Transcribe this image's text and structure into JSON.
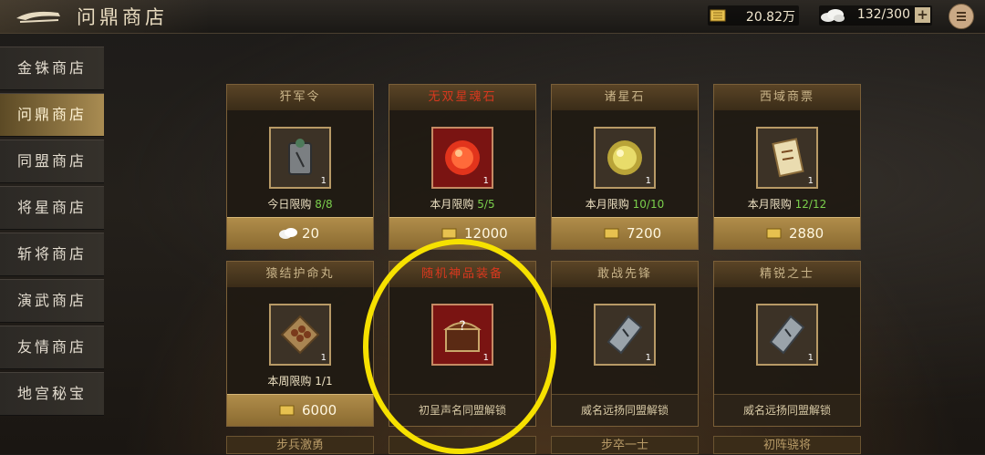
{
  "header": {
    "title": "问鼎商店",
    "gold_value": "20.82万",
    "jade_value": "132/300",
    "plus_label": "+"
  },
  "sidebar": {
    "items": [
      {
        "label": "金铢商店",
        "active": false
      },
      {
        "label": "问鼎商店",
        "active": true
      },
      {
        "label": "同盟商店",
        "active": false
      },
      {
        "label": "将星商店",
        "active": false
      },
      {
        "label": "斩将商店",
        "active": false
      },
      {
        "label": "演武商店",
        "active": false
      },
      {
        "label": "友情商店",
        "active": false
      },
      {
        "label": "地宫秘宝",
        "active": false
      }
    ]
  },
  "shop": {
    "cards": [
      {
        "name": "犴军令",
        "count": "1",
        "limit_label": "今日限购",
        "limit_value": "8/8",
        "price": "20",
        "currency_icon": "jade-icon",
        "item_icon": "token-icon"
      },
      {
        "name": "无双星魂石",
        "count": "1",
        "limit_label": "本月限购",
        "limit_value": "5/5",
        "price": "12000",
        "currency_icon": "gold-icon",
        "item_icon": "red-orb-icon"
      },
      {
        "name": "诸星石",
        "count": "1",
        "limit_label": "本月限购",
        "limit_value": "10/10",
        "price": "7200",
        "currency_icon": "gold-icon",
        "item_icon": "gold-orb-icon"
      },
      {
        "name": "西域商票",
        "count": "1",
        "limit_label": "本月限购",
        "limit_value": "12/12",
        "price": "2880",
        "currency_icon": "gold-icon",
        "item_icon": "scroll-icon"
      },
      {
        "name": "猿结护命丸",
        "count": "1",
        "limit_label": "本周限购",
        "limit_value": "1/1",
        "price": "6000",
        "currency_icon": "gold-icon",
        "item_icon": "pills-icon"
      },
      {
        "name": "随机神品装备",
        "count": "1",
        "unlock": "初呈声名同盟解锁",
        "item_icon": "chest-icon"
      },
      {
        "name": "敢战先锋",
        "count": "1",
        "unlock": "威名远扬同盟解锁",
        "item_icon": "silver-token-icon"
      },
      {
        "name": "精锐之士",
        "count": "1",
        "unlock": "威名远扬同盟解锁",
        "item_icon": "silver-token-icon"
      }
    ],
    "partial_row": [
      "步兵激勇",
      "",
      "步卒一士",
      "初阵骁将"
    ]
  },
  "colors": {
    "accent_gold": "#b08d4a",
    "highlight": "#f6e100",
    "red_title": "#d8381e",
    "limit_green": "#7bd04c"
  }
}
